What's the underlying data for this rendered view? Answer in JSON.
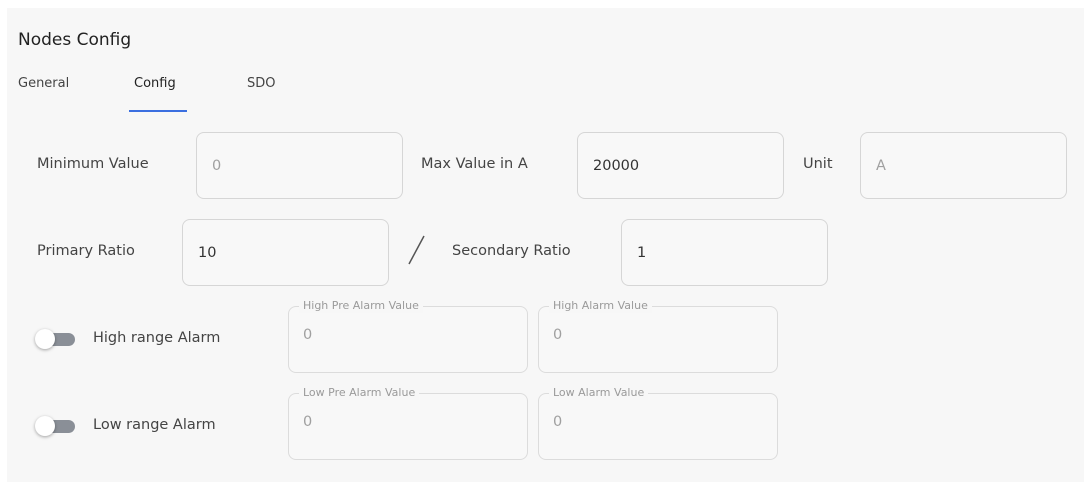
{
  "header": {
    "title": "Nodes Config"
  },
  "tabs": [
    {
      "label": "General",
      "active": false
    },
    {
      "label": "Config",
      "active": true
    },
    {
      "label": "SDO",
      "active": false
    }
  ],
  "accent_color": "#3b6fe0",
  "range": {
    "minimum_label": "Minimum Value",
    "minimum_value": "0",
    "max_label": "Max Value in A",
    "max_value": "20000",
    "unit_label": "Unit",
    "unit_value": "A"
  },
  "ratio": {
    "primary_label": "Primary Ratio",
    "primary_value": "10",
    "secondary_label": "Secondary Ratio",
    "secondary_value": "1"
  },
  "alarms": {
    "high": {
      "toggle_label": "High range Alarm",
      "toggle_on": false,
      "pre_alarm_label": "High Pre Alarm Value",
      "pre_alarm_value": "0",
      "alarm_label": "High Alarm Value",
      "alarm_value": "0"
    },
    "low": {
      "toggle_label": "Low range Alarm",
      "toggle_on": false,
      "pre_alarm_label": "Low Pre Alarm Value",
      "pre_alarm_value": "0",
      "alarm_label": "Low Alarm Value",
      "alarm_value": "0"
    }
  }
}
